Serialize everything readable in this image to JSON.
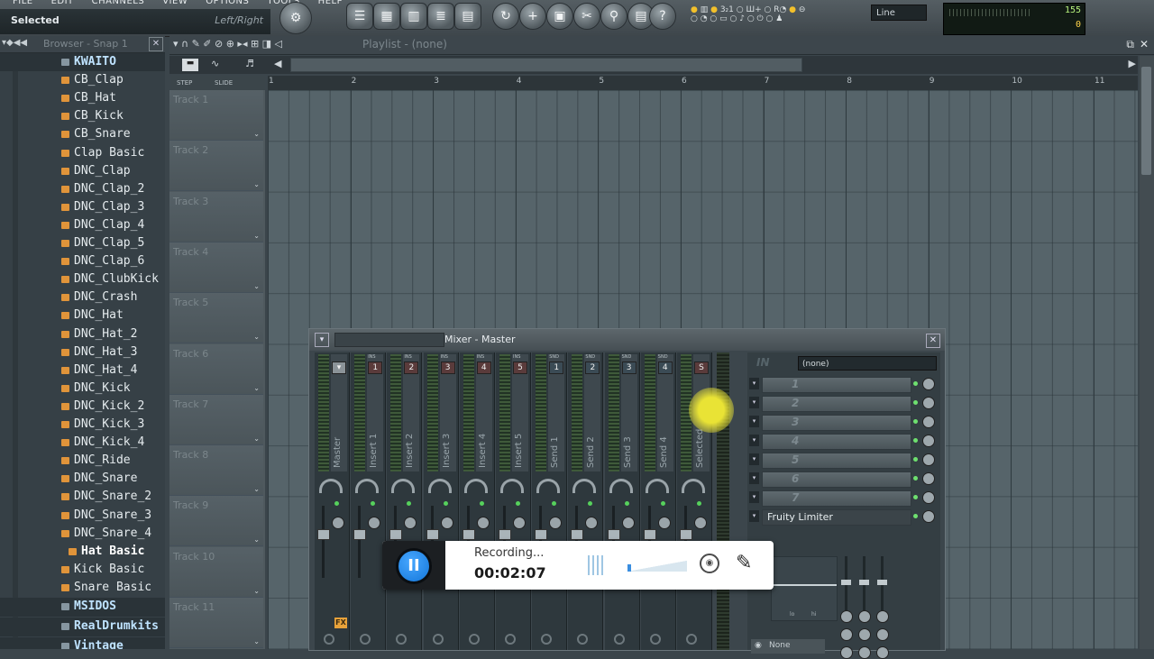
{
  "menu": [
    "FILE",
    "EDIT",
    "CHANNELS",
    "VIEW",
    "OPTIONS",
    "TOOLS",
    "HELP"
  ],
  "hint_bar": {
    "left": "Selected",
    "right": "Left/Right"
  },
  "toolbar": {
    "snap_mode": "Line",
    "perf_value_1": "155",
    "perf_value_2": "0"
  },
  "browser": {
    "title": "Browser - Snap 1",
    "items": [
      {
        "label": "KWAITO",
        "type": "folder"
      },
      {
        "label": "CB_Clap",
        "type": "file"
      },
      {
        "label": "CB_Hat",
        "type": "file"
      },
      {
        "label": "CB_Kick",
        "type": "file"
      },
      {
        "label": "CB_Snare",
        "type": "file"
      },
      {
        "label": "Clap Basic",
        "type": "file"
      },
      {
        "label": "DNC_Clap",
        "type": "file"
      },
      {
        "label": "DNC_Clap_2",
        "type": "file"
      },
      {
        "label": "DNC_Clap_3",
        "type": "file"
      },
      {
        "label": "DNC_Clap_4",
        "type": "file"
      },
      {
        "label": "DNC_Clap_5",
        "type": "file"
      },
      {
        "label": "DNC_Clap_6",
        "type": "file"
      },
      {
        "label": "DNC_ClubKick",
        "type": "file"
      },
      {
        "label": "DNC_Crash",
        "type": "file"
      },
      {
        "label": "DNC_Hat",
        "type": "file"
      },
      {
        "label": "DNC_Hat_2",
        "type": "file"
      },
      {
        "label": "DNC_Hat_3",
        "type": "file"
      },
      {
        "label": "DNC_Hat_4",
        "type": "file"
      },
      {
        "label": "DNC_Kick",
        "type": "file"
      },
      {
        "label": "DNC_Kick_2",
        "type": "file"
      },
      {
        "label": "DNC_Kick_3",
        "type": "file"
      },
      {
        "label": "DNC_Kick_4",
        "type": "file"
      },
      {
        "label": "DNC_Ride",
        "type": "file"
      },
      {
        "label": "DNC_Snare",
        "type": "file"
      },
      {
        "label": "DNC_Snare_2",
        "type": "file"
      },
      {
        "label": "DNC_Snare_3",
        "type": "file"
      },
      {
        "label": "DNC_Snare_4",
        "type": "file"
      },
      {
        "label": "Hat Basic",
        "type": "active"
      },
      {
        "label": "Kick Basic",
        "type": "file"
      },
      {
        "label": "Snare Basic",
        "type": "file"
      },
      {
        "label": "MSIDOS",
        "type": "folder"
      },
      {
        "label": "RealDrumkits",
        "type": "folder"
      },
      {
        "label": "Vintage",
        "type": "folder"
      }
    ]
  },
  "playlist": {
    "title": "Playlist - (none)",
    "step_label": "STEP",
    "slide_label": "SLIDE",
    "ruler": [
      "1",
      "2",
      "3",
      "4",
      "5",
      "6",
      "7",
      "8",
      "9",
      "10",
      "11"
    ],
    "tracks": [
      "Track 1",
      "Track 2",
      "Track 3",
      "Track 4",
      "Track 5",
      "Track 6",
      "Track 7",
      "Track 8",
      "Track 9",
      "Track 10",
      "Track 11"
    ]
  },
  "mixer": {
    "title": "Mixer - Master",
    "channels": [
      {
        "name": "Master",
        "tag": "",
        "num": ""
      },
      {
        "name": "Insert 1",
        "tag": "INS",
        "num": "1"
      },
      {
        "name": "Insert 2",
        "tag": "INS",
        "num": "2"
      },
      {
        "name": "Insert 3",
        "tag": "INS",
        "num": "3"
      },
      {
        "name": "Insert 4",
        "tag": "INS",
        "num": "4"
      },
      {
        "name": "Insert 5",
        "tag": "INS",
        "num": "5"
      },
      {
        "name": "Send 1",
        "tag": "SND",
        "num": "1"
      },
      {
        "name": "Send 2",
        "tag": "SND",
        "num": "2"
      },
      {
        "name": "Send 3",
        "tag": "SND",
        "num": "3"
      },
      {
        "name": "Send 4",
        "tag": "SND",
        "num": "4"
      },
      {
        "name": "Selected",
        "tag": "",
        "num": "S"
      }
    ],
    "in_label": "IN",
    "in_source": "(none)",
    "slots": [
      "1",
      "2",
      "3",
      "4",
      "5",
      "6",
      "7"
    ],
    "slot8": "Fruity Limiter",
    "eq_labels": [
      "lo",
      "hi"
    ],
    "out_none": "None",
    "fx_label": "FX"
  },
  "recorder": {
    "status": "Recording...",
    "time": "00:02:07"
  }
}
